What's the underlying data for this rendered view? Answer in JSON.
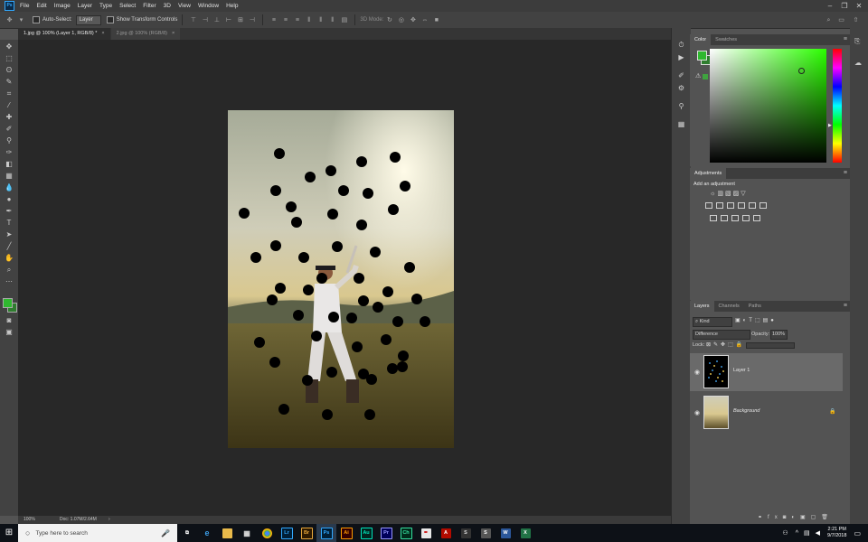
{
  "menu": {
    "items": [
      "File",
      "Edit",
      "Image",
      "Layer",
      "Type",
      "Select",
      "Filter",
      "3D",
      "View",
      "Window",
      "Help"
    ]
  },
  "options": {
    "auto_select_label": "Auto-Select:",
    "auto_select_value": "Layer",
    "transform_label": "Show Transform Controls",
    "mode_3d": "3D Mode:"
  },
  "tabs": [
    {
      "label": "1.jpg @ 100% (Layer 1, RGB/8) *"
    },
    {
      "label": "2.jpg @ 100% (RGB/8)"
    }
  ],
  "status": {
    "zoom": "100%",
    "doc": "Doc: 1.07M/2.64M"
  },
  "color_panel": {
    "tabs": [
      "Color",
      "Swatches"
    ],
    "foreground": "#2fb82f",
    "background": "#2f7d2f"
  },
  "adjustments": {
    "tab": "Adjustments",
    "subtitle": "Add an adjustment"
  },
  "layers_panel": {
    "tabs": [
      "Layers",
      "Channels",
      "Paths"
    ],
    "kind": "Kind",
    "blend_mode": "Difference",
    "opacity_label": "Opacity:",
    "opacity_value": "100%",
    "lock_label": "Lock:",
    "layers": [
      {
        "name": "Layer 1"
      },
      {
        "name": "Background"
      }
    ]
  },
  "taskbar": {
    "search_placeholder": "Type here to search",
    "time": "2:21 PM",
    "date": "9/7/2018",
    "apps": [
      {
        "label": "Lr",
        "color": "#31a8ff",
        "bg": "#001e36"
      },
      {
        "label": "Br",
        "color": "#e8a73a",
        "bg": "#2e1a00"
      },
      {
        "label": "Ps",
        "color": "#31a8ff",
        "bg": "#001e36"
      },
      {
        "label": "Ai",
        "color": "#ff9a00",
        "bg": "#330000"
      },
      {
        "label": "Au",
        "color": "#00e4bb",
        "bg": "#00251f"
      },
      {
        "label": "Pr",
        "color": "#9999ff",
        "bg": "#00005b"
      },
      {
        "label": "Ch",
        "color": "#35e0a0",
        "bg": "#002a1a"
      }
    ]
  }
}
